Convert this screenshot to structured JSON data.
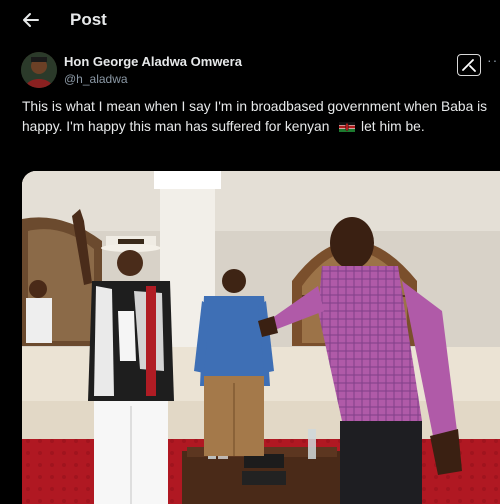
{
  "header": {
    "title": "Post",
    "back_icon": "arrow-left-icon"
  },
  "author": {
    "name": "Hon George Aladwa Omwera",
    "handle": "@h_aladwa",
    "avatar_icon": "profile-avatar"
  },
  "actions": {
    "grok_icon": "grok-icon",
    "more_icon": "more-dots-icon",
    "more_text": "··"
  },
  "post": {
    "text_part1": "This is what I mean when  I say I'm in broadbased government when Baba is happy. I'm happy  this man has suffered for kenyan ",
    "flag_icon": "kenya-flag-emoji",
    "text_part2": " let him be."
  },
  "media": {
    "type": "photo",
    "icon": "photo-image"
  },
  "colors": {
    "background": "#000000",
    "text": "#e7e9ea",
    "secondary_text": "#8b98a5"
  }
}
